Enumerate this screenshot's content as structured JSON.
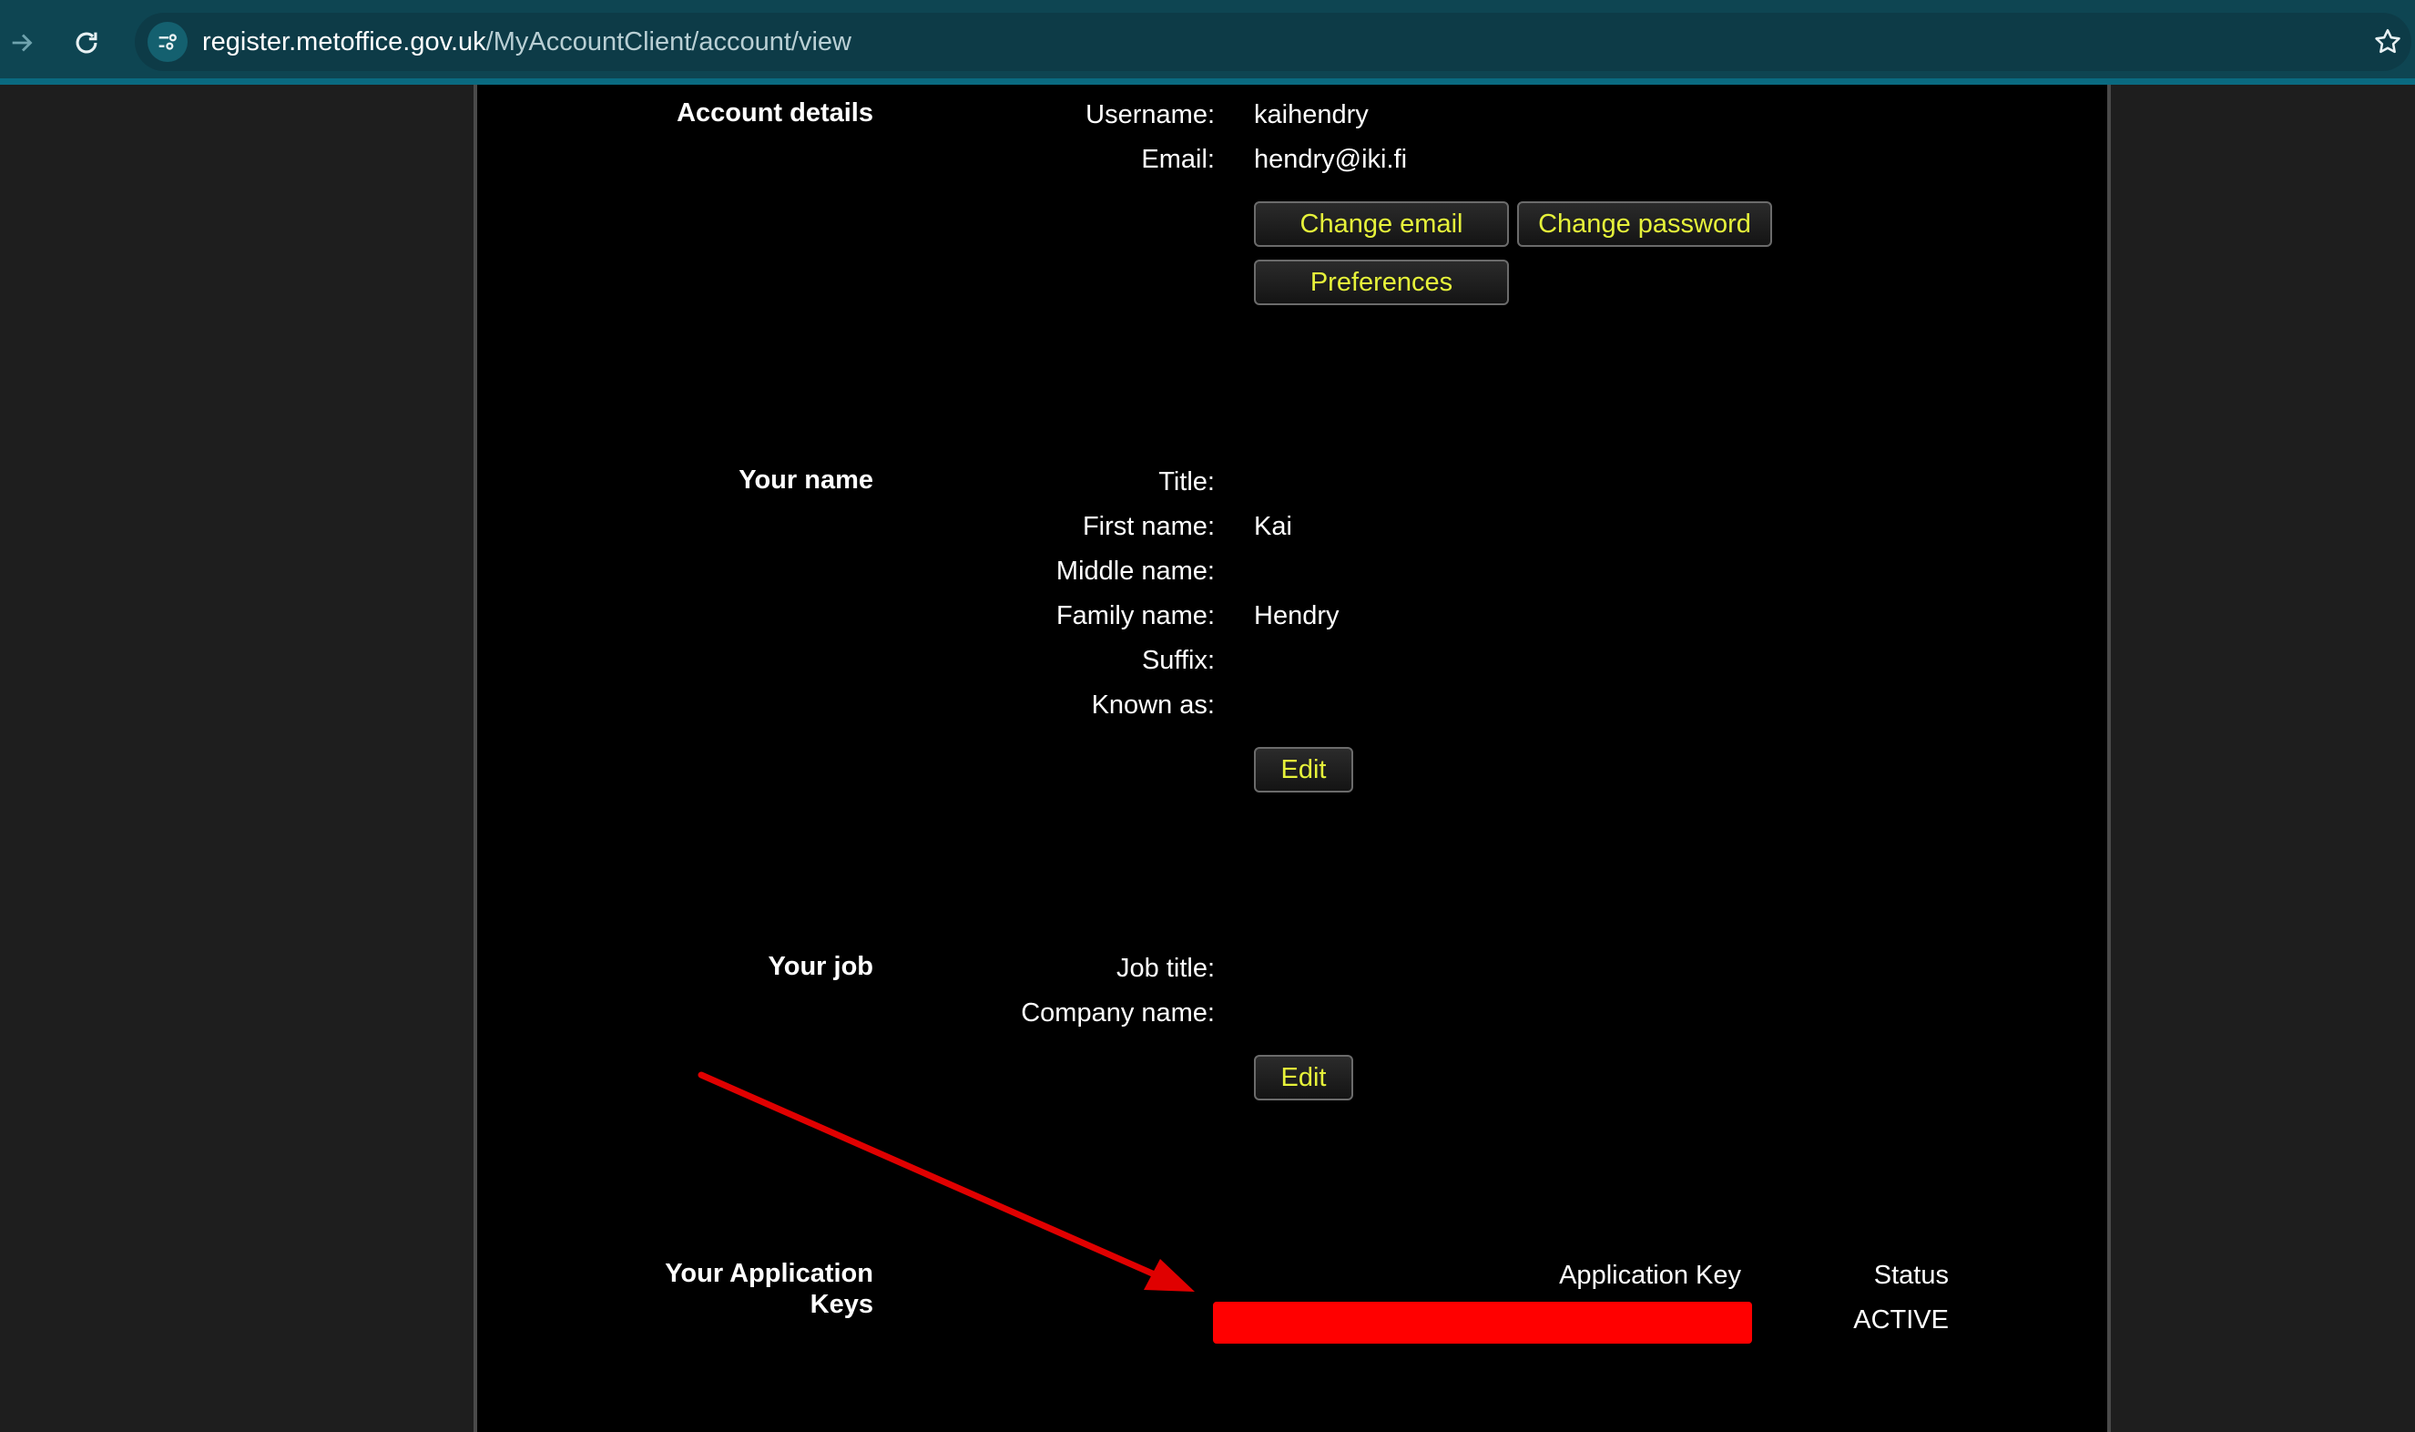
{
  "browser": {
    "url_host": "register.metoffice.gov.uk",
    "url_path": "/MyAccountClient/account/view",
    "icons": [
      "forward-icon",
      "reload-icon",
      "site-info-icon",
      "bookmark-star-icon"
    ]
  },
  "account_details": {
    "title": "Account details",
    "username_label": "Username:",
    "username": "kaihendry",
    "email_label": "Email:",
    "email": "hendry@iki.fi",
    "change_email": "Change email",
    "change_password": "Change password",
    "preferences": "Preferences"
  },
  "your_name": {
    "title": "Your name",
    "title_label": "Title:",
    "first_name_label": "First name:",
    "first_name": "Kai",
    "middle_name_label": "Middle name:",
    "family_name_label": "Family name:",
    "family_name": "Hendry",
    "suffix_label": "Suffix:",
    "known_as_label": "Known as:",
    "edit": "Edit"
  },
  "your_job": {
    "title": "Your job",
    "job_title_label": "Job title:",
    "company_name_label": "Company name:",
    "edit": "Edit"
  },
  "application_keys": {
    "title_line1": "Your Application",
    "title_line2": "Keys",
    "col_key": "Application Key",
    "col_status": "Status",
    "status": "ACTIVE"
  },
  "colors": {
    "button_text": "#e6f23a",
    "redaction": "#ff0000",
    "arrow": "#e00000",
    "toolbar": "#0e4552"
  }
}
